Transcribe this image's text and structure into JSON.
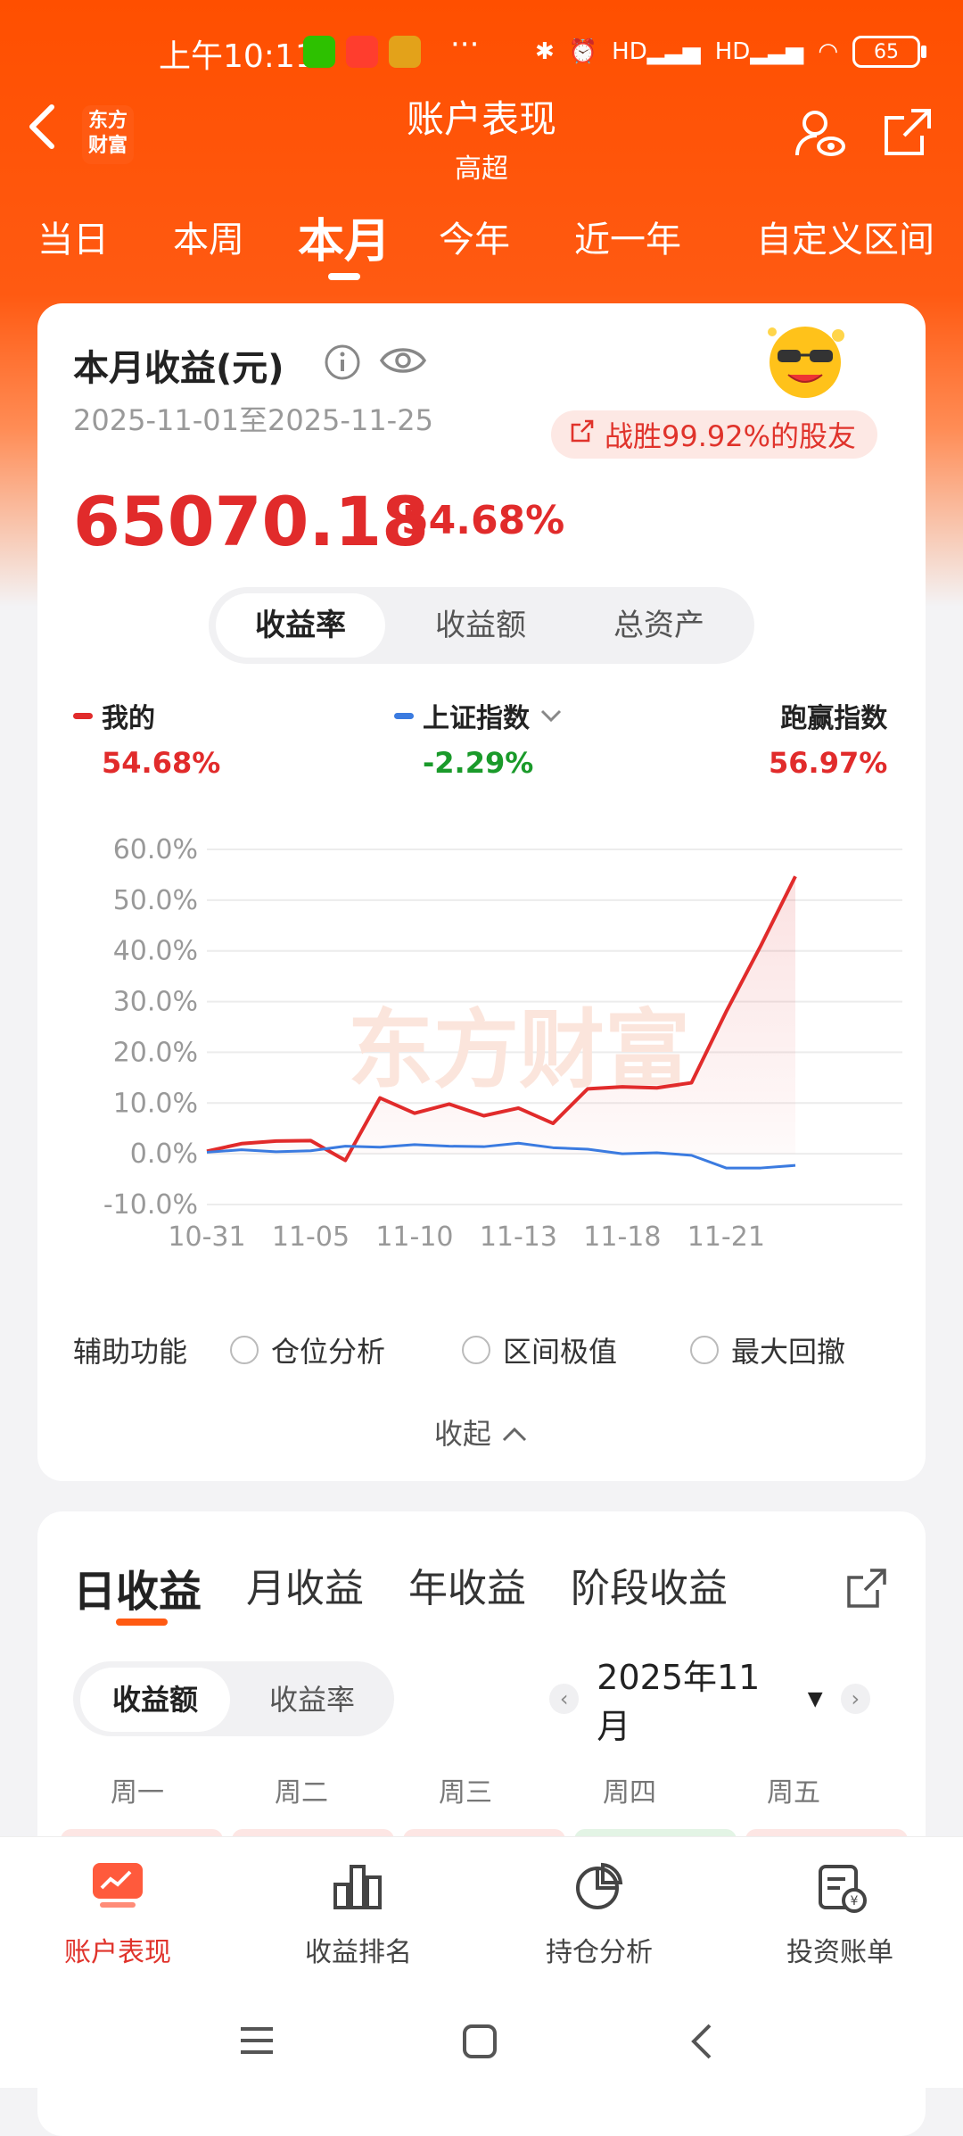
{
  "status_bar": {
    "time": "上午10:11",
    "dots": "···",
    "battery": "65",
    "signal1": "HD",
    "signal2": "HD"
  },
  "header": {
    "title": "账户表现",
    "subtitle": "高超",
    "logo_text_line1": "东方",
    "logo_text_line2": "财富"
  },
  "period_tabs": [
    {
      "label": "当日"
    },
    {
      "label": "本周"
    },
    {
      "label": "本月"
    },
    {
      "label": "今年"
    },
    {
      "label": "近一年"
    },
    {
      "label": "自定义区间"
    }
  ],
  "summary": {
    "title": "本月收益(元)",
    "date_range": "2025-11-01至2025-11-25",
    "beat_text": "战胜99.92%的股友",
    "amount": "65070.18",
    "return_pct": "54.68%",
    "segments": [
      "收益率",
      "收益额",
      "总资产"
    ]
  },
  "legend": {
    "mine": {
      "name": "我的",
      "value": "54.68%",
      "color": "#e12b2b"
    },
    "index": {
      "name": "上证指数",
      "value": "-2.29%",
      "color": "#3b7be0"
    },
    "beat": {
      "name": "跑赢指数",
      "value": "56.97%",
      "color": "#e12b2b"
    }
  },
  "chart_data": {
    "type": "line",
    "x_tick_labels": [
      "10-31",
      "11-05",
      "11-10",
      "11-13",
      "11-18",
      "11-21"
    ],
    "y_tick_labels": [
      "60.0%",
      "50.0%",
      "40.0%",
      "30.0%",
      "20.0%",
      "10.0%",
      "0.0%",
      "-10.0%"
    ],
    "ylim": [
      -10,
      60
    ],
    "x": [
      "10-31",
      "11-03",
      "11-04",
      "11-05",
      "11-06",
      "11-07",
      "11-10",
      "11-11",
      "11-12",
      "11-13",
      "11-14",
      "11-17",
      "11-18",
      "11-19",
      "11-20",
      "11-21",
      "11-24",
      "11-25"
    ],
    "series": [
      {
        "name": "我的",
        "color": "#e12b2b",
        "values": [
          0.5,
          2.0,
          2.5,
          2.6,
          -1.3,
          11.0,
          8.0,
          9.8,
          7.5,
          9.0,
          6.0,
          12.8,
          13.2,
          13.0,
          14.0,
          28.0,
          41.0,
          54.68
        ]
      },
      {
        "name": "上证指数",
        "color": "#3b7be0",
        "values": [
          0.3,
          0.8,
          0.4,
          0.6,
          1.5,
          1.3,
          1.8,
          1.5,
          1.4,
          2.1,
          1.2,
          0.9,
          0.0,
          0.2,
          -0.3,
          -2.8,
          -2.8,
          -2.29
        ]
      }
    ],
    "grid": true,
    "watermark": "东方财富"
  },
  "aux": {
    "label": "辅助功能",
    "options": [
      "仓位分析",
      "区间极值",
      "最大回撤"
    ],
    "collapse": "收起"
  },
  "earnings": {
    "tabs": [
      "日收益",
      "月收益",
      "年收益",
      "阶段收益"
    ],
    "segments": [
      "收益额",
      "收益率"
    ],
    "month": "2025年11月",
    "weekdays": [
      "周一",
      "周二",
      "周三",
      "周四",
      "周五"
    ]
  },
  "bottom_nav": [
    {
      "label": "账户表现",
      "icon": "account-performance-icon"
    },
    {
      "label": "收益排名",
      "icon": "bar-chart-icon"
    },
    {
      "label": "持仓分析",
      "icon": "pie-chart-icon"
    },
    {
      "label": "投资账单",
      "icon": "bill-icon"
    }
  ]
}
